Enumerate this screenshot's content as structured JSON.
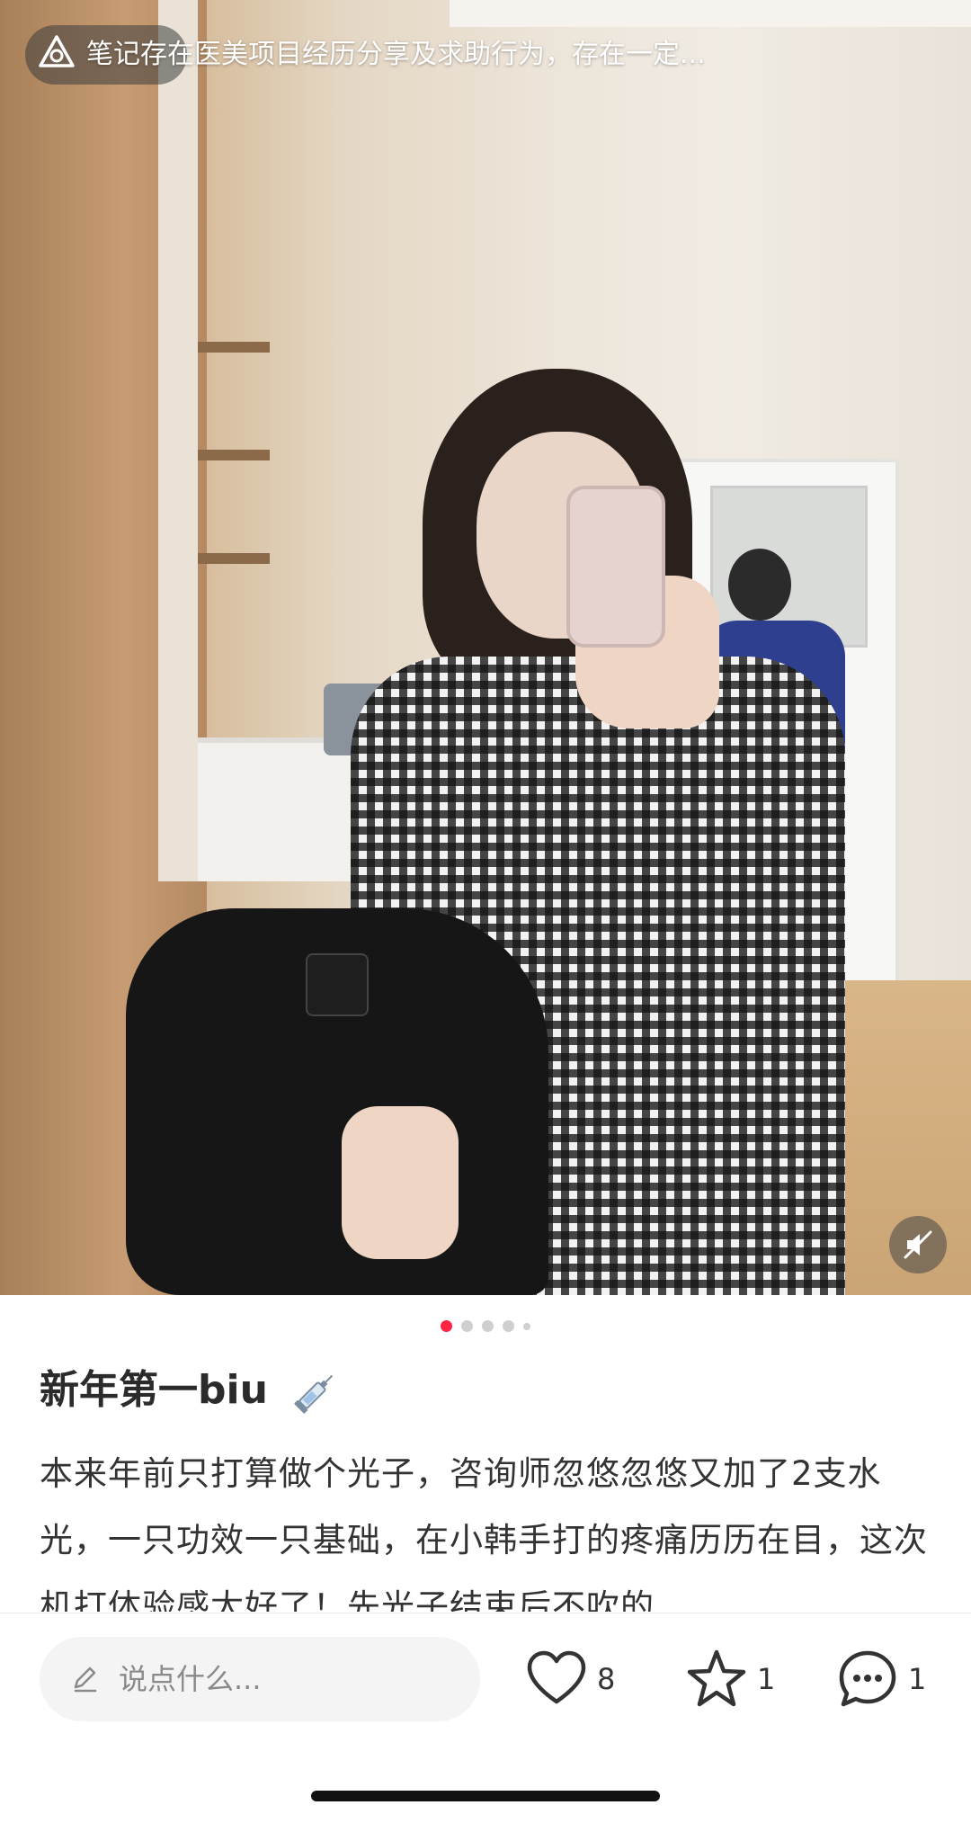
{
  "banner": {
    "warning_text": "笔记存在医美项目经历分享及求助行为，存在一定...",
    "icon": "warning-triangle-icon"
  },
  "media": {
    "mute_icon": "speaker-mute-icon",
    "page_count": 5,
    "current_page": 1
  },
  "post": {
    "title": "新年第一biu",
    "title_emoji_icon": "syringe-icon",
    "body": "本来年前只打算做个光子，咨询师忽悠忽悠又加了2支水光，一只功效一只基础，在小韩手打的疼痛历历在目，这次机打体验感太好了！先光子结束后不吹的"
  },
  "bottom_bar": {
    "comment_placeholder": "说点什么...",
    "like_count": "8",
    "collect_count": "1",
    "comment_count": "1"
  },
  "colors": {
    "accent": "#ff2442",
    "text": "#333333"
  }
}
